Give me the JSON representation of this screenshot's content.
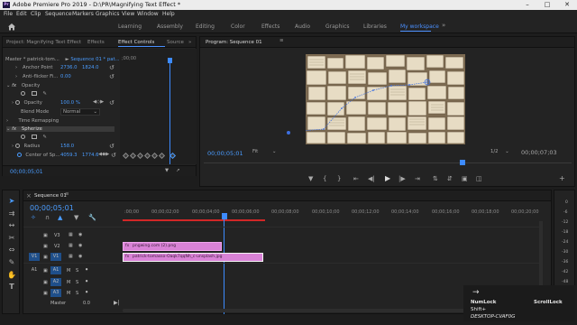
{
  "app": {
    "title": "Adobe Premiere Pro 2019 - D:\\PR\\Magnifying Text Effect *",
    "icon_text": "Pr",
    "controls": [
      "minimize-icon",
      "maximize-icon",
      "close-icon"
    ]
  },
  "menu": [
    "File",
    "Edit",
    "Clip",
    "Sequence",
    "Markers",
    "Graphics",
    "View",
    "Window",
    "Help"
  ],
  "workspaces": {
    "items": [
      "Learning",
      "Assembly",
      "Editing",
      "Color",
      "Effects",
      "Audio",
      "Graphics",
      "Libraries",
      "My workspace"
    ],
    "active": "My workspace"
  },
  "left_panel": {
    "tabs": [
      "Project: Magnifying Text Effect",
      "Effects",
      "Effect Controls",
      "Source"
    ],
    "active_tab": "Effect Controls",
    "clip_header": "Master * patrick-tom...",
    "clip_target": "Sequence 01 * pat...",
    "ruler_time": ";00;00",
    "rows": {
      "anchor_label": "Anchor Point",
      "anchor_x": "2736.0",
      "anchor_y": "1824.0",
      "antiflicker_label": "Anti-flicker Fi...",
      "antiflicker_val": "0.00",
      "opacity_section": "Opacity",
      "opacity_label": "Opacity",
      "opacity_val": "100.0 %",
      "blend_label": "Blend Mode",
      "blend_val": "Normal",
      "timeremap_label": "Time Remapping",
      "spherize_label": "Spherize",
      "radius_label": "Radius",
      "radius_val": "158.0",
      "center_label": "Center of Sp...",
      "center_x": "4059.3",
      "center_y": "1774.6"
    },
    "timecode": "00;00;05;01"
  },
  "program": {
    "title": "Program: Sequence 01",
    "timecode_left": "00;00;05;01",
    "fit": "Fit",
    "resolution": "1/2",
    "timecode_right": "00;00;07;03"
  },
  "timeline": {
    "tab": "Sequence 01",
    "timecode": "00;00;05;01",
    "ruler": ":00;00",
    "r2": "00;00;02;00",
    "r3": "00;00;04;00",
    "r4": "00;00;06;00",
    "r5": "00;00;08;00",
    "r6": "00;00;10;00",
    "r7": "00;00;12;00",
    "r8": "00;00;14;00",
    "r9": "00;00;16;00",
    "r10": "00;00;18;00",
    "r11": "00;00;20;00",
    "tracks": {
      "v3": "V3",
      "v2": "V2",
      "v1": "V1",
      "v1src": "V1",
      "a1": "A1",
      "a1src": "A1",
      "a2": "A2",
      "a3": "A3",
      "master": "Master",
      "master_val": "0.0"
    },
    "clip_v2": "pngwing.com (2).png",
    "clip_v1": "patrick-tomasso-Oaqk7qqNh_c-unsplash.jpg"
  },
  "audio_meter": [
    "0",
    "-6",
    "-12",
    "-18",
    "-24",
    "-30",
    "-36",
    "-42",
    "-48",
    "-54"
  ],
  "overlay": {
    "arrow": "→",
    "numlock": "NumLock",
    "scrolllock": "ScrollLock",
    "shift": "Shift+",
    "machine": "DESKTOP-CVAF0G"
  },
  "colors": {
    "accent": "#4a90ff",
    "clip_pink": "#d982d6",
    "playhead": "#3d8bff",
    "render_bar": "#d12727"
  }
}
